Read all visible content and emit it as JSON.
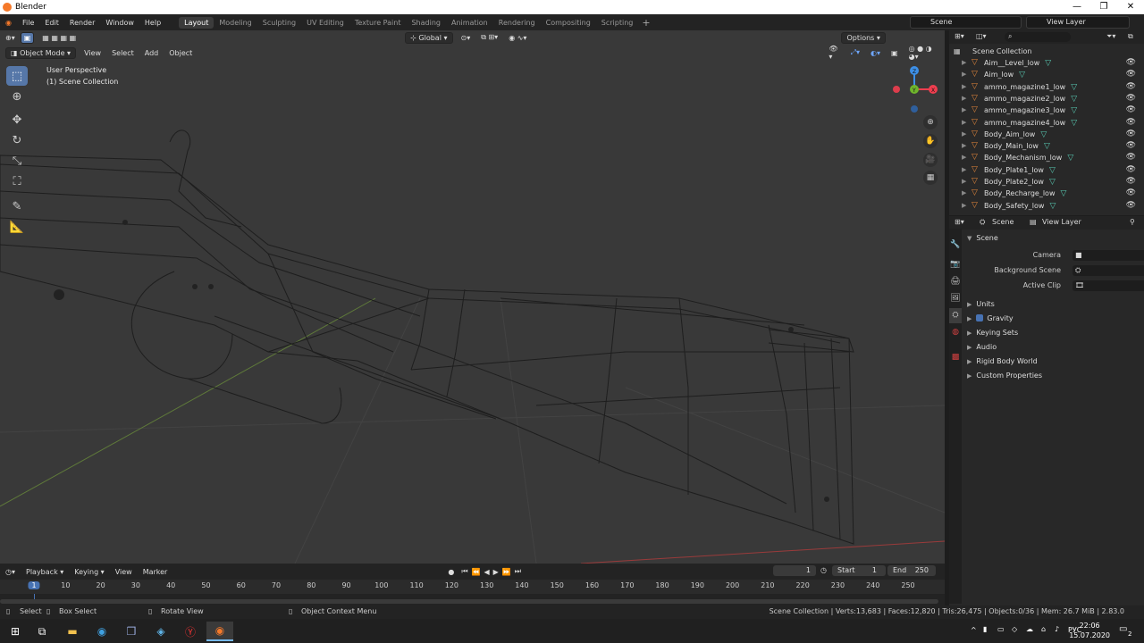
{
  "window": {
    "title": "Blender",
    "controls": [
      "—",
      "❐",
      "✕"
    ]
  },
  "menus": [
    "File",
    "Edit",
    "Render",
    "Window",
    "Help"
  ],
  "workspaces": [
    "Layout",
    "Modeling",
    "Sculpting",
    "UV Editing",
    "Texture Paint",
    "Shading",
    "Animation",
    "Rendering",
    "Compositing",
    "Scripting"
  ],
  "active_workspace": "Layout",
  "scene_field": "Scene",
  "viewlayer_field": "View Layer",
  "viewport": {
    "mode": "Object Mode",
    "menus": [
      "View",
      "Select",
      "Add",
      "Object"
    ],
    "transform_orientation": "Global",
    "options_label": "Options",
    "info_line1": "User Perspective",
    "info_line2": "(1) Scene Collection",
    "gizmo": {
      "x": "X",
      "y": "Y",
      "z": "Z"
    }
  },
  "outliner": {
    "root": "Scene Collection",
    "items": [
      "Aim__Level_low",
      "Aim_low",
      "ammo_magazine1_low",
      "ammo_magazine2_low",
      "ammo_magazine3_low",
      "ammo_magazine4_low",
      "Body_Aim_low",
      "Body_Main_low",
      "Body_Mechanism_low",
      "Body_Plate1_low",
      "Body_Plate2_low",
      "Body_Recharge_low",
      "Body_Safety_low"
    ]
  },
  "properties": {
    "tab_scene": "Scene",
    "tab_viewlayer": "View Layer",
    "section": "Scene",
    "fields": [
      {
        "label": "Camera"
      },
      {
        "label": "Background Scene"
      },
      {
        "label": "Active Clip"
      }
    ],
    "panels": [
      "Units",
      "Gravity",
      "Keying Sets",
      "Audio",
      "Rigid Body World",
      "Custom Properties"
    ]
  },
  "timeline": {
    "menus": [
      "Playback",
      "Keying",
      "View",
      "Marker"
    ],
    "current_frame": "1",
    "start_label": "Start",
    "start": "1",
    "end_label": "End",
    "end": "250",
    "ticks": [
      "1",
      "10",
      "20",
      "30",
      "40",
      "50",
      "60",
      "70",
      "80",
      "90",
      "100",
      "110",
      "120",
      "130",
      "140",
      "150",
      "160",
      "170",
      "180",
      "190",
      "200",
      "210",
      "220",
      "230",
      "240",
      "250"
    ]
  },
  "status": {
    "select": "Select",
    "box_select": "Box Select",
    "rotate_view": "Rotate View",
    "context_menu": "Object Context Menu",
    "stats": "Scene Collection | Verts:13,683 | Faces:12,820 | Tris:26,475 | Objects:0/36 | Mem: 26.7 MiB | 2.83.0"
  },
  "taskbar": {
    "lang": "РУС",
    "time": "22:06",
    "date": "15.07.2020",
    "notif": "2"
  },
  "colors": {
    "accent": "#4772b3",
    "object": "#e0843a",
    "mesh": "#58c7b0",
    "x_axis": "#f03e4f",
    "y_axis": "#6fb52c",
    "z_axis": "#3d8fe6"
  }
}
